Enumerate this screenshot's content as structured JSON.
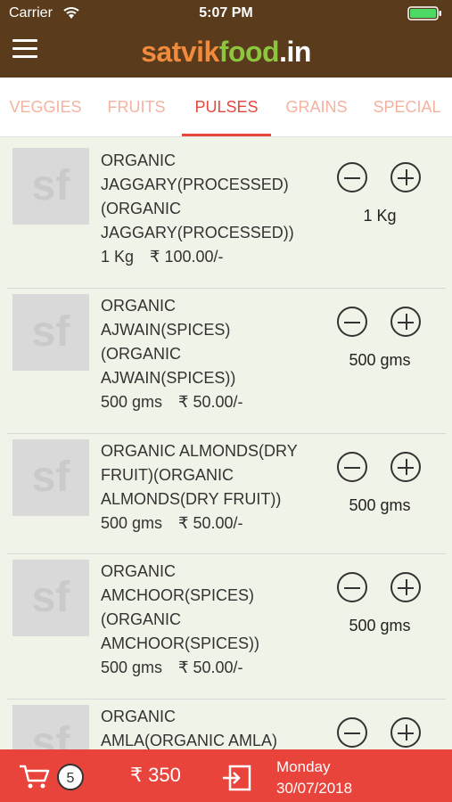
{
  "status": {
    "carrier": "Carrier",
    "time": "5:07 PM"
  },
  "brand": {
    "part1": "satvik",
    "part2": "food",
    "part3": ".in"
  },
  "tabs": [
    "VEGGIES",
    "FRUITS",
    "PULSES",
    "GRAINS",
    "SPECIAL"
  ],
  "active_tab": "PULSES",
  "items": [
    {
      "thumb": "sf",
      "name": "ORGANIC\nJAGGARY(PROCESSED)\n(ORGANIC\nJAGGARY(PROCESSED))",
      "unit": "1 Kg",
      "price": "₹ 100.00/-",
      "qty": "1 Kg"
    },
    {
      "thumb": "sf",
      "name": "ORGANIC\nAJWAIN(SPICES)\n(ORGANIC\nAJWAIN(SPICES))",
      "unit": "500 gms",
      "price": "₹ 50.00/-",
      "qty": "500 gms"
    },
    {
      "thumb": "sf",
      "name": "ORGANIC ALMONDS(DRY\nFRUIT)(ORGANIC\nALMONDS(DRY FRUIT))",
      "unit": "500 gms",
      "price": "₹ 50.00/-",
      "qty": "500 gms"
    },
    {
      "thumb": "sf",
      "name": "ORGANIC\nAMCHOOR(SPICES)\n(ORGANIC\nAMCHOOR(SPICES))",
      "unit": "500 gms",
      "price": "₹ 50.00/-",
      "qty": "500 gms"
    },
    {
      "thumb": "sf",
      "name": "ORGANIC\nAMLA(ORGANIC AMLA)",
      "unit": "",
      "price": "",
      "qty": ""
    }
  ],
  "footer": {
    "cart_count": "5",
    "total": "₹ 350",
    "day": "Monday",
    "date": "30/07/2018"
  },
  "colors": {
    "header": "#5a3b1c",
    "accent": "#e8473c",
    "footer": "#e9443c",
    "background": "#f0f3e7"
  }
}
